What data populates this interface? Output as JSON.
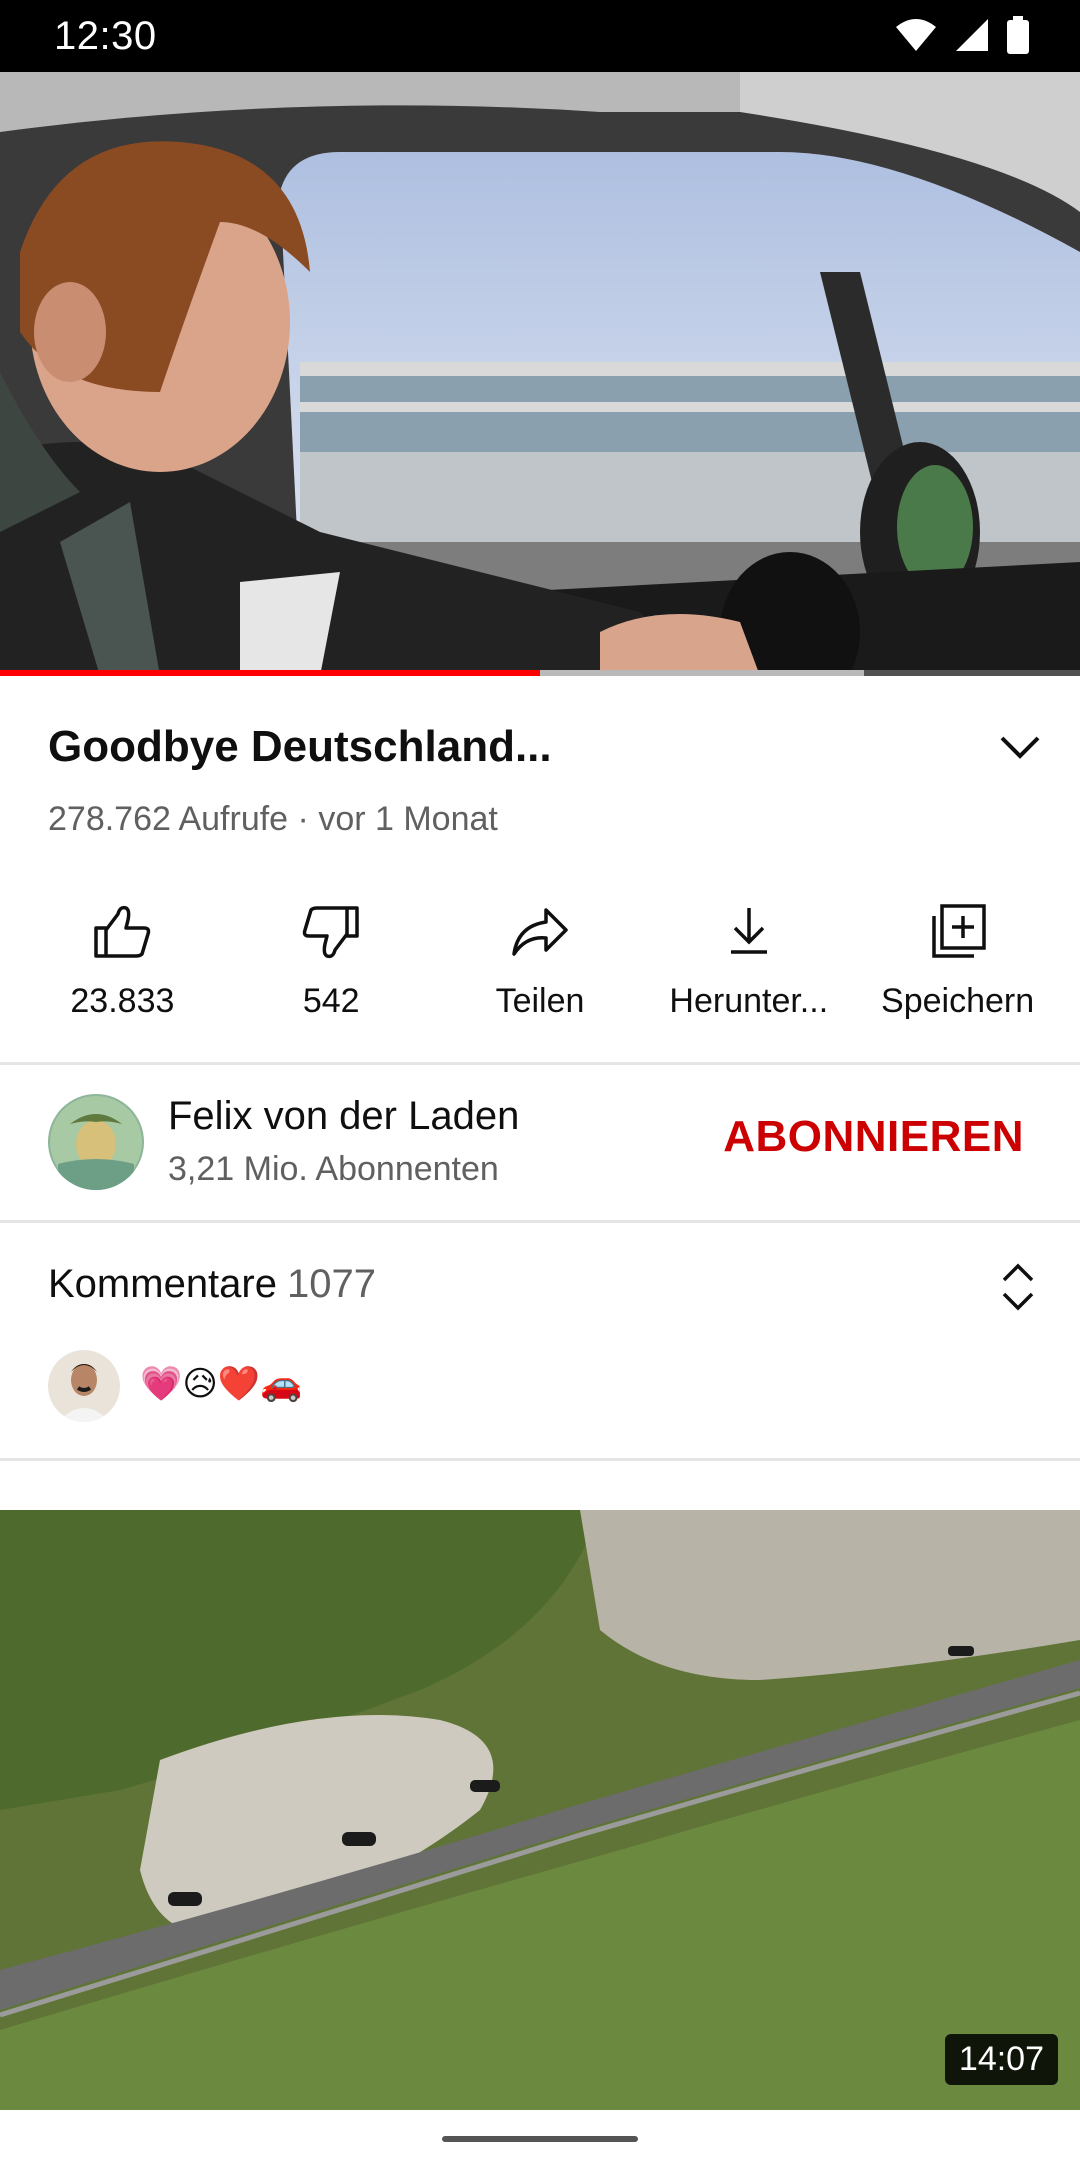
{
  "status_bar": {
    "time": "12:30",
    "icons": [
      "wifi-icon",
      "cellular-signal-icon",
      "battery-icon"
    ]
  },
  "player": {
    "progress_fraction": 0.5,
    "buffered_fraction": 0.8,
    "accent_color": "#ff0000"
  },
  "video": {
    "title": "Goodbye Deutschland...",
    "views": "278.762 Aufrufe",
    "age": "· vor 1 Monat"
  },
  "actions": [
    {
      "icon": "thumbs-up-icon",
      "label": "23.833"
    },
    {
      "icon": "thumbs-down-icon",
      "label": "542"
    },
    {
      "icon": "share-icon",
      "label": "Teilen"
    },
    {
      "icon": "download-icon",
      "label": "Herunter..."
    },
    {
      "icon": "save-to-playlist-icon",
      "label": "Speichern"
    }
  ],
  "channel": {
    "name": "Felix von der Laden",
    "subscribers": "3,21 Mio. Abonnenten",
    "subscribe_label": "ABONNIEREN",
    "subscribe_color": "#cc0000"
  },
  "comments": {
    "title": "Kommentare",
    "count": "1077",
    "preview": "💗😥❤️🚗"
  },
  "next_video": {
    "duration": "14:07"
  }
}
